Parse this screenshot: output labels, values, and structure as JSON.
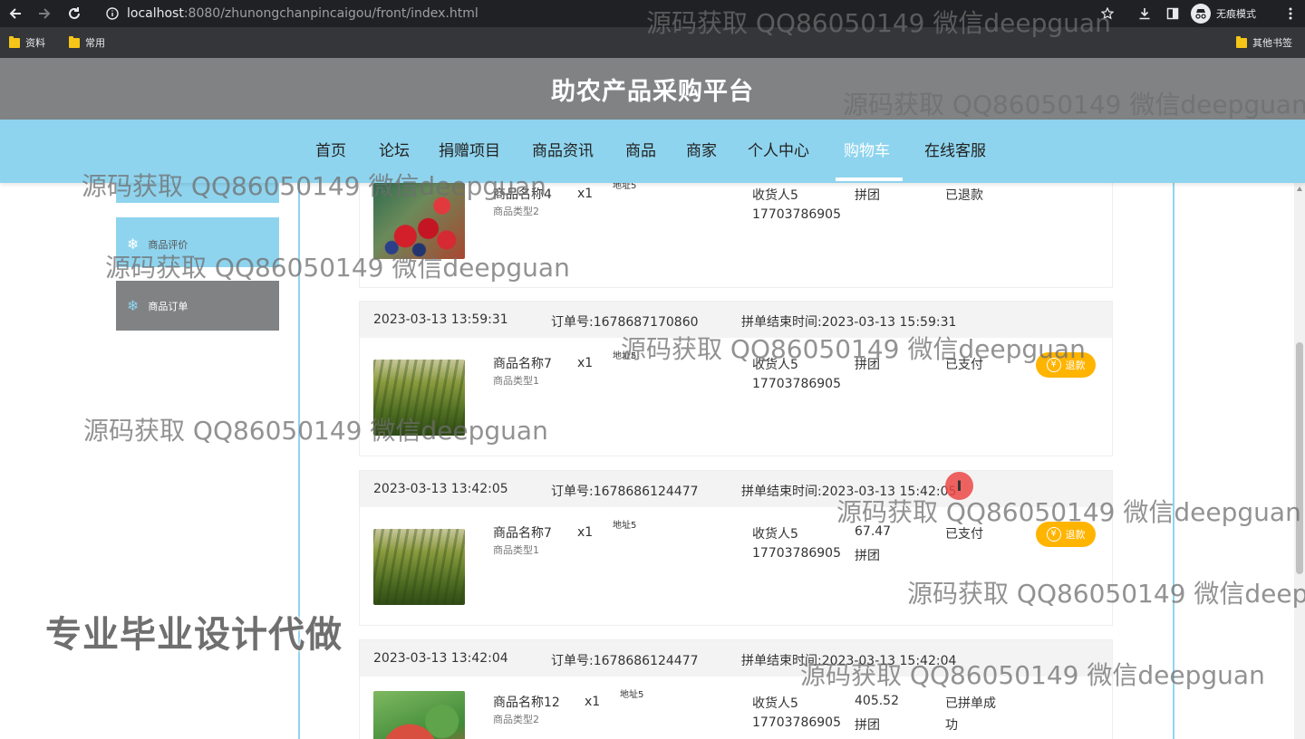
{
  "browser": {
    "url_host": "localhost",
    "url_path": ":8080/zhunongchanpincaigou/front/index.html",
    "incognito_label": "无痕模式",
    "bookmarks": [
      "资料",
      "常用"
    ],
    "other_bookmarks": "其他书签"
  },
  "site": {
    "title": "助农产品采购平台",
    "nav": [
      "首页",
      "论坛",
      "捐赠项目",
      "商品资讯",
      "商品",
      "商家",
      "个人中心",
      "购物车",
      "在线客服"
    ],
    "active_nav": "购物车"
  },
  "sidebar": {
    "items": [
      {
        "label": "商品评价"
      },
      {
        "label": "商品订单"
      }
    ]
  },
  "orders": [
    {
      "product_name": "商品名称4",
      "product_type": "商品类型2",
      "qty": "x1",
      "address": "地址5",
      "receiver": "收货人5",
      "phone": "17703786905",
      "group_label": "拼团",
      "status": "已退款"
    },
    {
      "time": "2023-03-13 13:59:31",
      "order_no": "订单号:1678687170860",
      "end_time": "拼单结束时间:2023-03-13 15:59:31",
      "product_name": "商品名称7",
      "product_type": "商品类型1",
      "qty": "x1",
      "address": "地址5",
      "receiver": "收货人5",
      "phone": "17703786905",
      "group_label": "拼团",
      "status": "已支付",
      "action": "退款"
    },
    {
      "time": "2023-03-13 13:42:05",
      "order_no": "订单号:1678686124477",
      "end_time": "拼单结束时间:2023-03-13 15:42:05",
      "product_name": "商品名称7",
      "product_type": "商品类型1",
      "qty": "x1",
      "address": "地址5",
      "receiver": "收货人5",
      "phone": "17703786905",
      "price": "67.47",
      "group_label": "拼团",
      "status": "已支付",
      "action": "退款"
    },
    {
      "time": "2023-03-13 13:42:04",
      "order_no": "订单号:1678686124477",
      "end_time": "拼单结束时间:2023-03-13 15:42:04",
      "product_name": "商品名称12",
      "product_type": "商品类型2",
      "qty": "x1",
      "address": "地址5",
      "receiver": "收货人5",
      "phone": "17703786905",
      "price": "405.52",
      "group_label": "拼团",
      "status_line1": "已拼单成",
      "status_line2": "功"
    }
  ],
  "overlay": {
    "watermark": "源码获取 QQ86050149 微信deepguan",
    "promo": "专业毕业设计代做"
  },
  "colors": {
    "header_gray": "#808284",
    "nav_blue": "#8fd4ee",
    "refund_orange": "#ffb400"
  }
}
